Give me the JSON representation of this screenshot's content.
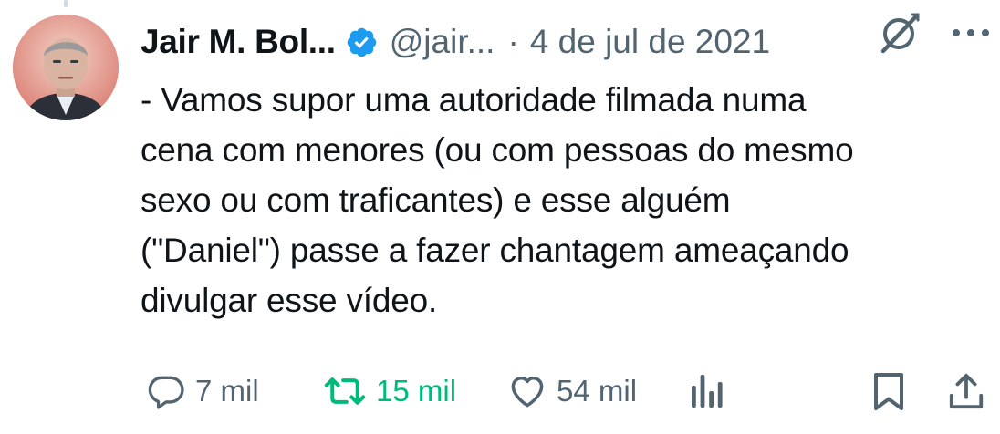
{
  "tweet": {
    "author": {
      "display_name": "Jair M. Bol...",
      "handle": "@jair...",
      "verified": true
    },
    "separator": "·",
    "date": "4 de jul de 2021",
    "text_lines": [
      "- Vamos supor uma autoridade filmada numa",
      "cena com menores (ou com pessoas do mesmo",
      "sexo ou com traficantes) e esse alguém",
      "(\"Daniel\") passe a fazer chantagem ameaçando",
      "divulgar esse vídeo."
    ],
    "actions": {
      "replies": "7 mil",
      "retweets": "15 mil",
      "likes": "54 mil"
    }
  },
  "icons": {
    "verified": "verified-badge-icon",
    "grok": "grok-icon",
    "more": "more-dots-icon",
    "reply": "reply-bubble-icon",
    "retweet": "retweet-arrows-icon",
    "like": "heart-icon",
    "views": "analytics-bars-icon",
    "bookmark": "bookmark-icon",
    "share": "share-upload-icon"
  },
  "colors": {
    "text_primary": "#0f1419",
    "text_secondary": "#536471",
    "verified_blue": "#1d9bf0",
    "retweet_green": "#00ba7c"
  }
}
